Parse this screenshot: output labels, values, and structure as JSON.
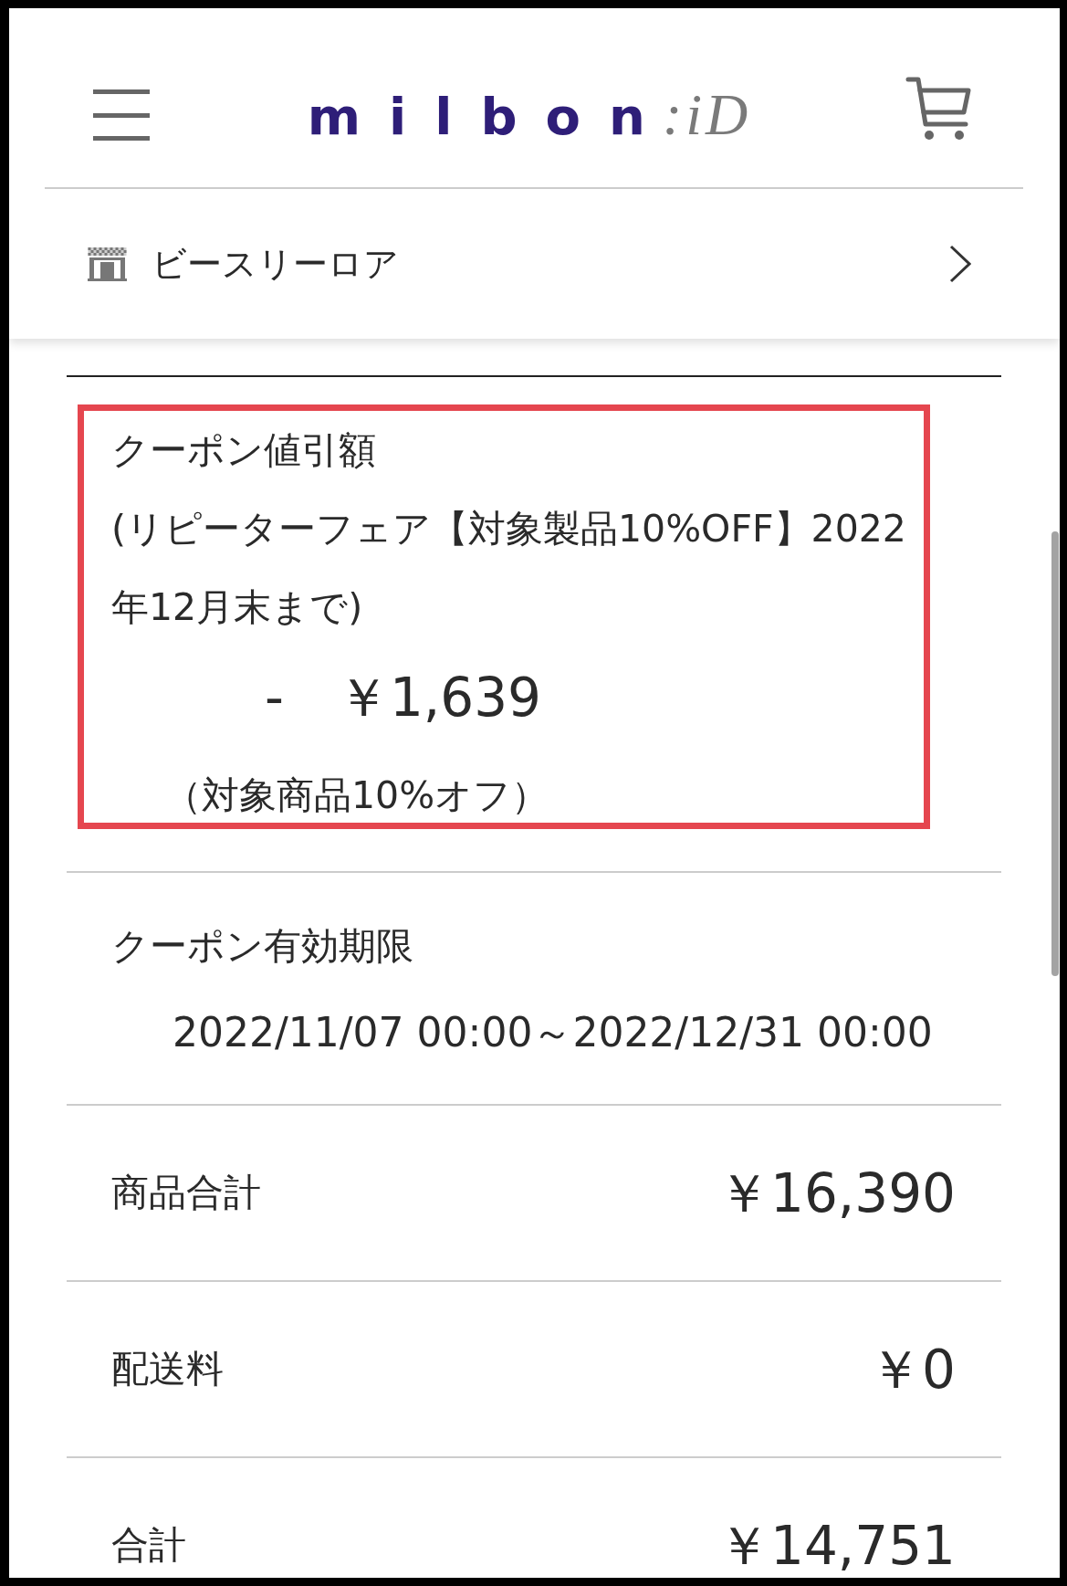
{
  "header": {
    "logo": {
      "wordmark": "milbon",
      "suffix": ":iD"
    }
  },
  "store": {
    "name": "ビースリーロア"
  },
  "coupon": {
    "highlighted": true,
    "label": "クーポン値引額",
    "name": "(リピーターフェア【対象製品10%OFF】2022年12月末まで)",
    "amount": "-　￥1,639",
    "note": "（対象商品10%オフ）"
  },
  "validity": {
    "label": "クーポン有効期限",
    "period": "2022/11/07 00:00～2022/12/31 00:00"
  },
  "summary": [
    {
      "label": "商品合計",
      "value": "￥16,390"
    },
    {
      "label": "配送料",
      "value": "￥0"
    },
    {
      "label": "合計",
      "value": "￥14,751"
    }
  ]
}
